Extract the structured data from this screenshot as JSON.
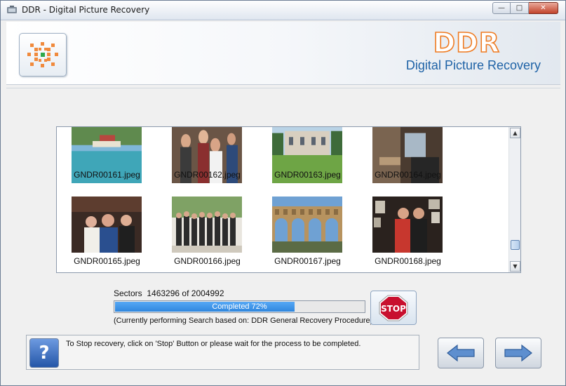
{
  "window": {
    "title": "DDR - Digital Picture Recovery"
  },
  "header": {
    "brand": "DDR",
    "subtitle": "Digital Picture Recovery"
  },
  "thumbnails": [
    {
      "name": "GNDR00161.jpeg",
      "scene": "harbor"
    },
    {
      "name": "GNDR00162.jpeg",
      "scene": "party"
    },
    {
      "name": "GNDR00163.jpeg",
      "scene": "house"
    },
    {
      "name": "GNDR00164.jpeg",
      "scene": "interior"
    },
    {
      "name": "GNDR00165.jpeg",
      "scene": "friends"
    },
    {
      "name": "GNDR00166.jpeg",
      "scene": "group"
    },
    {
      "name": "GNDR00167.jpeg",
      "scene": "aqueduct"
    },
    {
      "name": "GNDR00168.jpeg",
      "scene": "two-men"
    }
  ],
  "progress": {
    "sectors_label": "Sectors",
    "sectors_current": "1463296",
    "sectors_of": "of",
    "sectors_total": "2004992",
    "percent": 72,
    "status_text": "Completed 72%",
    "note": "(Currently performing Search based on:  DDR General Recovery Procedure)"
  },
  "buttons": {
    "stop": "STOP",
    "help": "?"
  },
  "info": {
    "text": "To Stop recovery, click on 'Stop' Button or please wait for the process to be completed."
  },
  "colors": {
    "brand": "#ef7b22",
    "subtitle": "#1e62a6",
    "progress": "#3a8ee6",
    "stop": "#c8102e"
  }
}
